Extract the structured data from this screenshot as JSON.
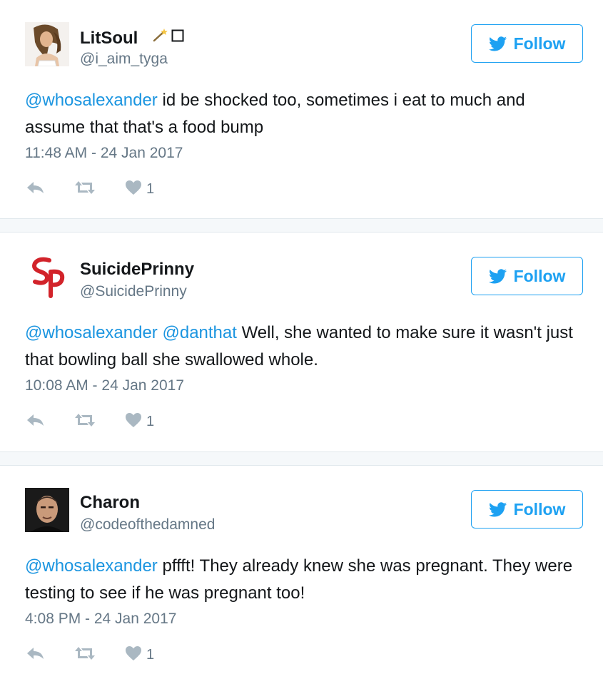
{
  "follow_label": "Follow",
  "tweets": [
    {
      "display_name": "LitSoul",
      "handle": "@i_aim_tyga",
      "mentions": [
        "@whosalexander"
      ],
      "body": " id be shocked too, sometimes i eat to much and assume that that's a food bump",
      "timestamp": "11:48 AM - 24 Jan 2017",
      "likes": "1",
      "name_decorations": [
        "magic-wand-icon",
        "white-square-icon"
      ]
    },
    {
      "display_name": "SuicidePrinny",
      "handle": "@SuicidePrinny",
      "mentions": [
        "@whosalexander",
        "@danthat"
      ],
      "body": " Well, she wanted to make sure it wasn't just that bowling ball she swallowed whole.",
      "timestamp": "10:08 AM - 24 Jan 2017",
      "likes": "1",
      "avatar_logo_text": "SP"
    },
    {
      "display_name": "Charon",
      "handle": "@codeofthedamned",
      "mentions": [
        "@whosalexander"
      ],
      "body": " pffft! They already knew she was pregnant. They were testing to see if he was pregnant too!",
      "timestamp": "4:08 PM - 24 Jan 2017",
      "likes": "1"
    }
  ],
  "colors": {
    "link_blue": "#1b95e0",
    "follow_blue": "#1da1f2",
    "text": "#14171a",
    "muted": "#657786",
    "icon_gray": "#aab8c2",
    "sp_red": "#d2232a"
  }
}
